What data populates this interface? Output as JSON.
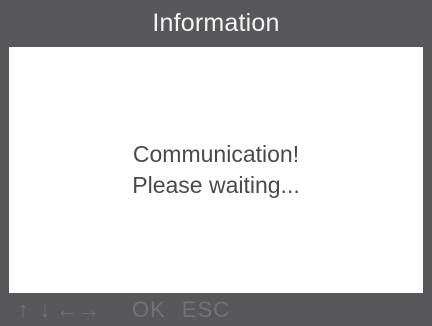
{
  "header": {
    "title": "Information"
  },
  "message": {
    "line1": "Communication!",
    "line2": "Please waiting..."
  },
  "footer": {
    "up_icon": "↑",
    "down_icon": "↓",
    "left_icon": "←",
    "right_icon": "→",
    "ok_label": "OK",
    "esc_label": "ESC"
  },
  "colors": {
    "frame": "#58585a",
    "screen": "#ffffff",
    "title_text": "#f4f4f4",
    "message_text": "#4a4a4a",
    "footer_text": "#727274"
  }
}
